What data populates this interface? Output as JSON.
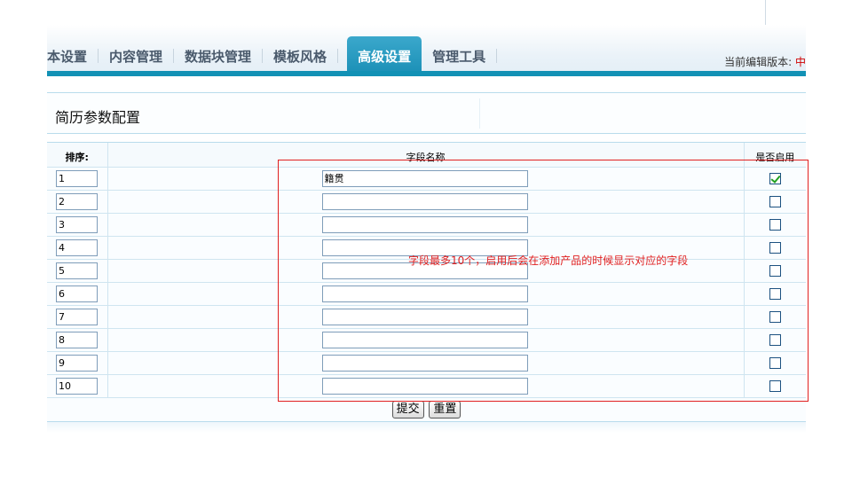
{
  "nav": {
    "items": [
      {
        "label": "本设置",
        "active": false
      },
      {
        "label": "内容管理",
        "active": false
      },
      {
        "label": "数据块管理",
        "active": false
      },
      {
        "label": "模板风格",
        "active": false
      },
      {
        "label": "高级设置",
        "active": true
      },
      {
        "label": "管理工具",
        "active": false
      }
    ],
    "version_label": "当前编辑版本:",
    "version_value": "中"
  },
  "panel": {
    "title": "简历参数配置"
  },
  "table": {
    "headers": {
      "sort": "排序:",
      "name": "字段名称",
      "enabled": "是否启用"
    },
    "rows": [
      {
        "sort": "1",
        "name": "籍贯",
        "enabled": true
      },
      {
        "sort": "2",
        "name": "",
        "enabled": false
      },
      {
        "sort": "3",
        "name": "",
        "enabled": false
      },
      {
        "sort": "4",
        "name": "",
        "enabled": false
      },
      {
        "sort": "5",
        "name": "",
        "enabled": false
      },
      {
        "sort": "6",
        "name": "",
        "enabled": false
      },
      {
        "sort": "7",
        "name": "",
        "enabled": false
      },
      {
        "sort": "8",
        "name": "",
        "enabled": false
      },
      {
        "sort": "9",
        "name": "",
        "enabled": false
      },
      {
        "sort": "10",
        "name": "",
        "enabled": false
      }
    ]
  },
  "buttons": {
    "submit": "提交",
    "reset": "重置"
  },
  "annotation": {
    "text": "字段最多10个，启用后会在添加产品的时候显示对应的字段",
    "color": "#e02020"
  },
  "colors": {
    "accent": "#1291b5",
    "tab_active": "#2a9bc2"
  }
}
